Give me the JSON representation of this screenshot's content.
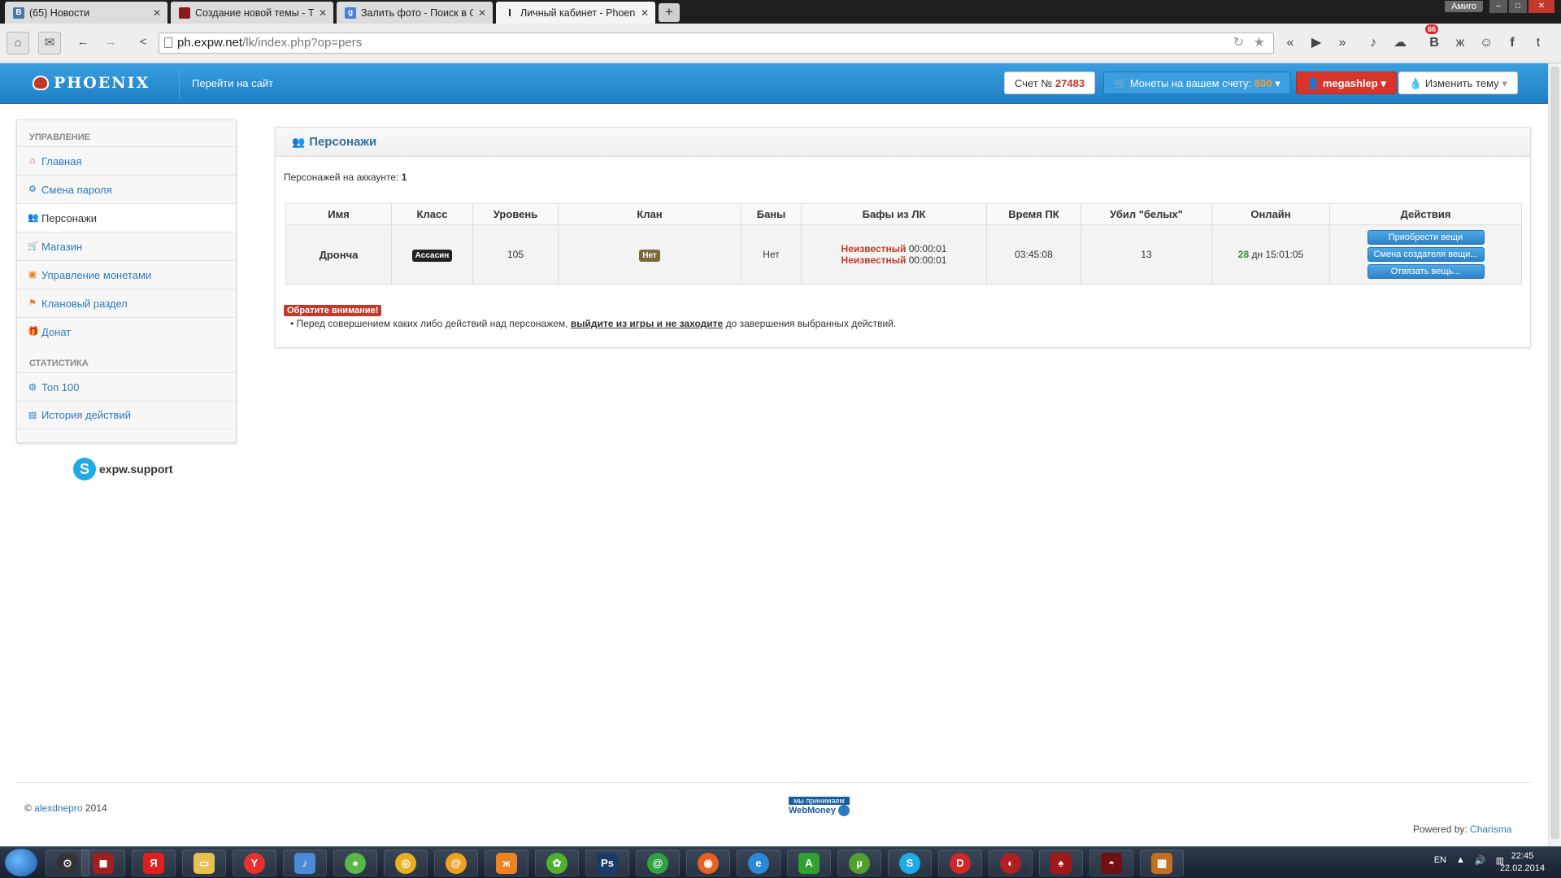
{
  "browser": {
    "tabs": [
      {
        "title": "(65) Новости",
        "favicon": "vk-icon",
        "color": "#4a76a8",
        "glyph": "В"
      },
      {
        "title": "Создание новой темы - Th",
        "favicon": "forum-icon",
        "color": "#8b1a1a",
        "glyph": ""
      },
      {
        "title": "Залить фото - Поиск в Goo",
        "favicon": "google-icon",
        "color": "#4a7fd4",
        "glyph": "g"
      },
      {
        "title": "Личный кабинет - Phoenix",
        "favicon": "cursor-icon",
        "color": "#ffffff",
        "glyph": "I"
      }
    ],
    "profile_label": "Амиго",
    "url_host": "ph.expw.net",
    "url_path": "/lk/index.php?op=pers",
    "vk_badge": "66"
  },
  "site": {
    "brand": "PHOENIX",
    "go_to_site": "Перейти на сайт",
    "account_label": "Счет №",
    "account_number": "27483",
    "coins_label": "Монеты на вашем счету:",
    "coins_value": "800",
    "username": "megashlep",
    "theme_label": "Изменить тему"
  },
  "sidebar": {
    "section_manage": "Управление",
    "section_stats": "Статистика",
    "items": [
      {
        "label": "Главная",
        "icon": "home-icon"
      },
      {
        "label": "Смена пароля",
        "icon": "gear-icon"
      },
      {
        "label": "Персонажи",
        "icon": "users-icon"
      },
      {
        "label": "Магазин",
        "icon": "cart-icon"
      },
      {
        "label": "Управление монетами",
        "icon": "coins-icon"
      },
      {
        "label": "Клановый раздел",
        "icon": "flag-icon"
      },
      {
        "label": "Донат",
        "icon": "gift-icon"
      }
    ],
    "stats_items": [
      {
        "label": "Топ 100",
        "icon": "globe-icon"
      },
      {
        "label": "История действий",
        "icon": "document-icon"
      }
    ],
    "skype": "expw.support"
  },
  "content": {
    "title": "Персонажи",
    "count_label": "Персонажей на аккаунте:",
    "count_value": "1",
    "columns": [
      "Имя",
      "Класс",
      "Уровень",
      "Клан",
      "Баны",
      "Бафы из ЛК",
      "Время ПК",
      "Убил \"белых\"",
      "Онлайн",
      "Действия"
    ],
    "row": {
      "name": "Дрончa",
      "class": "Ассасин",
      "level": "105",
      "clan": "Нет",
      "bans": "Нет",
      "buff1_name": "Неизвестный",
      "buff1_time": "00:00:01",
      "buff2_name": "Неизвестный",
      "buff2_time": "00:00:01",
      "pk_time": "03:45:08",
      "kills": "13",
      "online_days": "28",
      "online_rest": "дн 15:01:05"
    },
    "actions": [
      "Приобрести вещи",
      "Смена создателя вещи...",
      "Отвязать вещь..."
    ],
    "warning_title": "Обратите внимание!",
    "warning_pre": "Перед совершением каких либо действий над персонажем,",
    "warning_link": "выйдите из игры и не заходите",
    "warning_post": "до завершения выбранных действий."
  },
  "footer": {
    "copy_symbol": "©",
    "author": "alexdnepro",
    "year": "2014",
    "webmoney_top": "мы принимаем",
    "webmoney": "WebMoney",
    "powered_label": "Powered by:",
    "powered_link": "Charisma"
  },
  "taskbar": {
    "lang": "EN",
    "time": "22:45",
    "date": "22.02.2014"
  }
}
